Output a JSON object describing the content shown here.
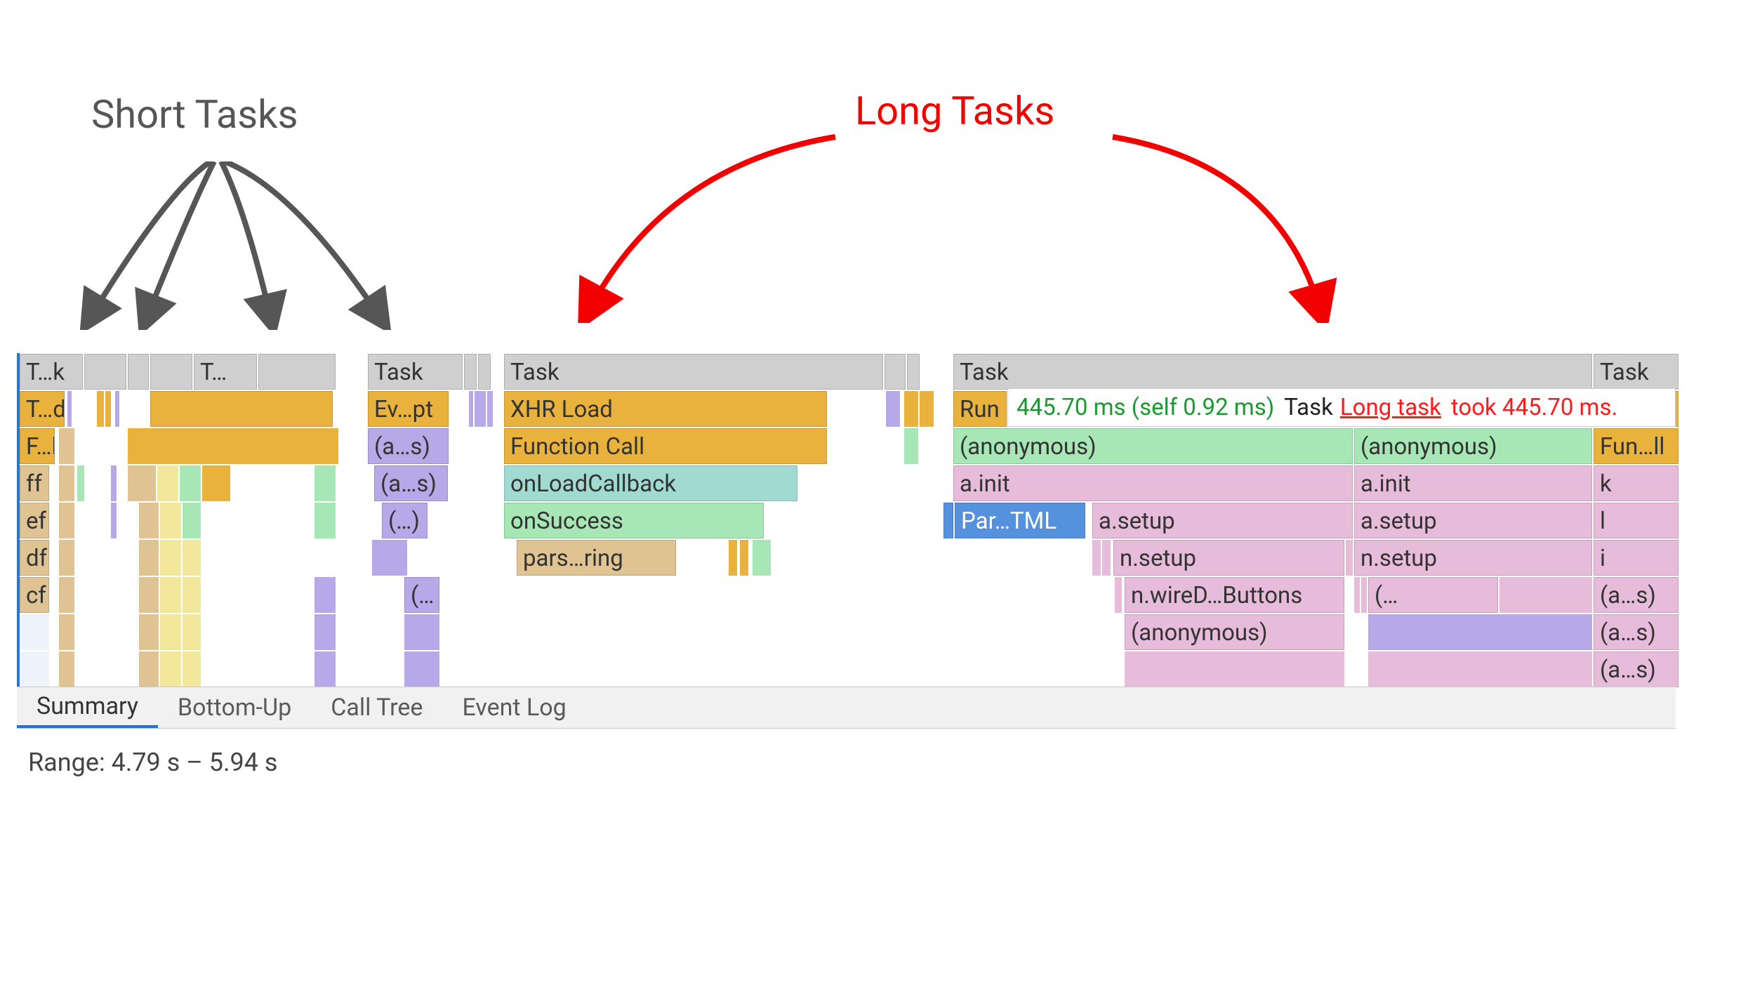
{
  "annotations": {
    "short_tasks": "Short Tasks",
    "long_tasks": "Long Tasks"
  },
  "tooltip": {
    "time": "445.70 ms (self 0.92 ms)",
    "label": "Task",
    "long_link": "Long task",
    "took": "took 445.70 ms."
  },
  "tabs": {
    "summary": "Summary",
    "bottom_up": "Bottom-Up",
    "call_tree": "Call Tree",
    "event_log": "Event Log"
  },
  "range": "Range:  4.79 s – 5.94 s",
  "flame": {
    "row0": {
      "tk": "T…k",
      "t": "T…",
      "task1": "Task",
      "task2": "Task",
      "task3": "Task",
      "task4": "Task"
    },
    "row1": {
      "td": "T…d",
      "evpt": "Ev…pt",
      "xhr": "XHR Load",
      "run": "Run "
    },
    "row2": {
      "fl": "F…l",
      "as1": "(a…s)",
      "fn": "Function Call",
      "anon1": "(anonymous)",
      "anon2": "(anonymous)",
      "funll": "Fun…ll"
    },
    "row3": {
      "ff": "ff",
      "as2": "(a…s)",
      "onload": "onLoadCallback",
      "ainit1": "a.init",
      "ainit2": "a.init",
      "k": "k"
    },
    "row4": {
      "ef": "ef",
      "paren": "(…)",
      "onsucc": "onSuccess",
      "partml": "Par…TML",
      "asetup1": "a.setup",
      "asetup2": "a.setup",
      "l": "l"
    },
    "row5": {
      "df": "df",
      "pars": "pars…ring",
      "nsetup1": "n.setup",
      "nsetup2": "n.setup",
      "i": "i"
    },
    "row6": {
      "cf": "cf",
      "paren2": "(…",
      "nwire": "n.wireD…Buttons",
      "paren3": "(…",
      "as3": "(a…s)"
    },
    "row7": {
      "anon3": "(anonymous)",
      "as4": "(a…s)"
    },
    "row8": {
      "as5": "(a…s)"
    }
  }
}
